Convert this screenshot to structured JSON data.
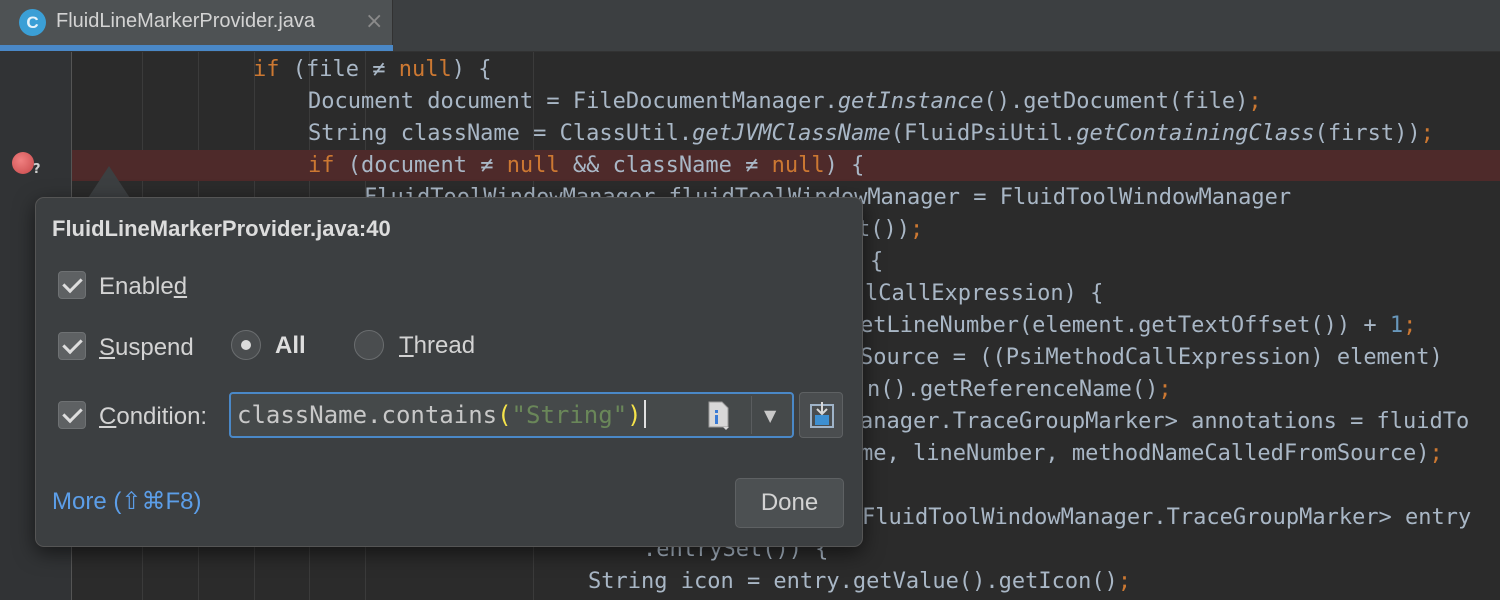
{
  "tab": {
    "icon_letter": "C",
    "title": "FluidLineMarkerProvider.java",
    "close": "×"
  },
  "colors": {
    "keyword": "#cc7832",
    "number": "#6897bb",
    "string": "#6a8759",
    "breakpoint": "#c7484a",
    "accent": "#4a88c7",
    "link": "#5c9ee8"
  },
  "icons": {
    "file_type": "java-class-icon",
    "breakpoint": "breakpoint-icon",
    "doc": "documentation-icon",
    "dropdown": "chevron-down-icon",
    "expand": "expand-editor-icon"
  },
  "code": {
    "l1": {
      "kw1": "if",
      "t1": " (file ≠ ",
      "kw2": "null",
      "t2": ") {"
    },
    "l2": {
      "t1": "Document document = FileDocumentManager.",
      "i1": "getInstance",
      "t2": "().getDocument(file)",
      "semi": ";"
    },
    "l3": {
      "t1": "String className = ClassUtil.",
      "i1": "getJVMClassName",
      "t2": "(FluidPsiUtil.",
      "i2": "getContainingClass",
      "t3": "(first))",
      "semi": ";"
    },
    "l4": {
      "kw1": "if",
      "t1": " (document ≠ ",
      "kw2": "null",
      "t2": " && className ≠ ",
      "kw3": "null",
      "t3": ") {"
    },
    "l5": {
      "t1": "FluidToolWindowManager fluidToolWindowManager = FluidToolWindowManager"
    },
    "l6": {
      "t1": "t())",
      "semi": ";"
    },
    "l7": {
      "t1": "{"
    },
    "l8": {
      "t1": "lCallExpression) {"
    },
    "l9": {
      "t1": "etLineNumber(element.getTextOffset()) + ",
      "n1": "1",
      "semi": ";"
    },
    "l10": {
      "t1": "Source = ((PsiMethodCallExpression) element)"
    },
    "l11": {
      "t1": "n().getReferenceName()",
      "semi": ";"
    },
    "l12": {
      "t1": "anager.TraceGroupMarker> annotations = fluidTo"
    },
    "l13": {
      "t1": "me, lineNumber, methodNameCalledFromSource)",
      "semi": ";"
    },
    "l14": {
      "t1": "FluidToolWindowManager.TraceGroupMarker> entry"
    },
    "l15": {
      "t1": ".entrySet()) {"
    },
    "l16": {
      "t1": "String icon = entry.getValue().getIcon()",
      "semi": ";"
    }
  },
  "breakpoint_marker": {
    "suffix": "?"
  },
  "popup": {
    "title": "FluidLineMarkerProvider.java:40",
    "enabled": {
      "label_pre": "Enable",
      "label_mn": "d",
      "checked": true
    },
    "suspend": {
      "label_mn": "S",
      "label_post": "uspend",
      "checked": true
    },
    "suspend_policy": {
      "all": {
        "label": "All",
        "selected": true
      },
      "thread": {
        "label_mn": "T",
        "label_post": "hread",
        "selected": false
      }
    },
    "condition": {
      "label_mn": "C",
      "label_post": "ondition:",
      "checked": true,
      "value_pre": "className.contains",
      "paren_open": "(",
      "value_str": "\"String\"",
      "paren_close": ")"
    },
    "more_link": "More (⇧⌘F8)",
    "done_button": "Done"
  }
}
